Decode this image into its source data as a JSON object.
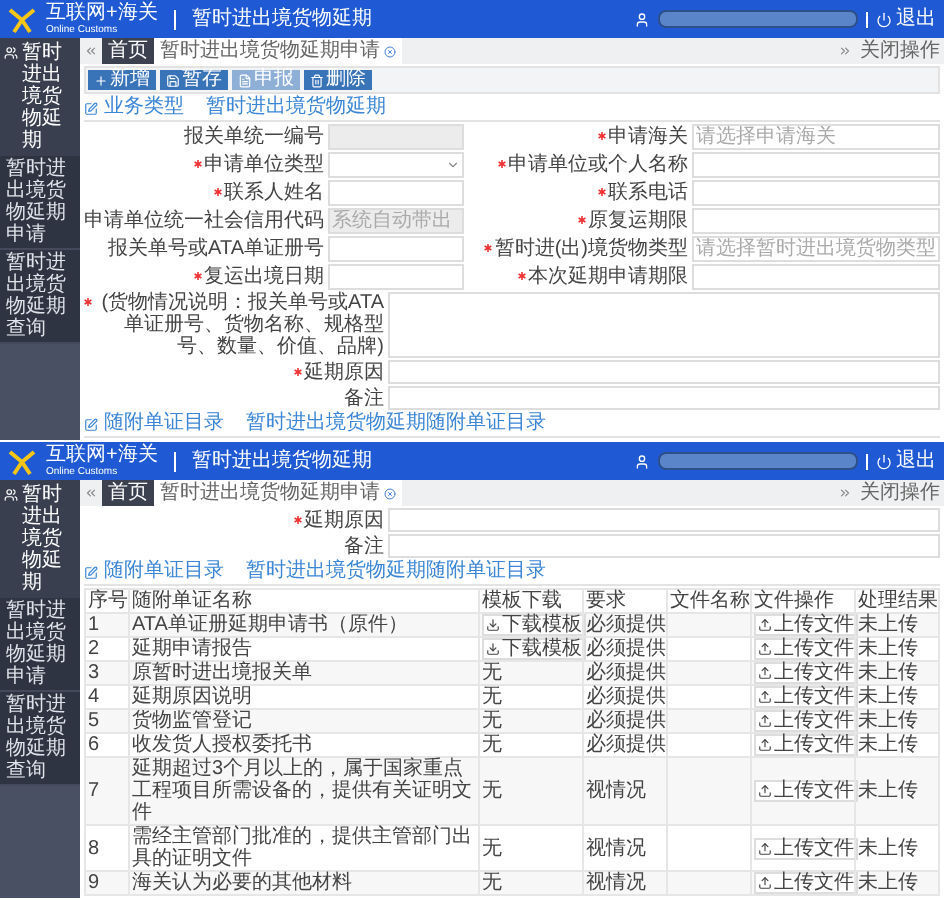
{
  "top_view": {
    "header": {
      "logo_cn": "互联网+海关",
      "logo_en": "Online Customs",
      "title": "暂时进出境货物延期",
      "logout": "退出"
    },
    "sidebar": {
      "group": "暂时进出境货物延期",
      "items": [
        {
          "label": "暂时进出境货物延期申请"
        },
        {
          "label": "暂时进出境货物延期查询"
        }
      ]
    },
    "tabs": {
      "items": [
        {
          "label": "首页",
          "selected": false,
          "closable": false
        },
        {
          "label": "暂时进出境货物延期申请",
          "selected": true,
          "closable": true
        }
      ],
      "close_menu": "关闭操作"
    },
    "toolbar": [
      {
        "kind": "add",
        "label": "新增",
        "disabled": false
      },
      {
        "kind": "save",
        "label": "暂存",
        "disabled": false
      },
      {
        "kind": "declare",
        "label": "申报",
        "disabled": true
      },
      {
        "kind": "delete",
        "label": "删除",
        "disabled": false
      }
    ],
    "section": {
      "title": "业务类型",
      "subtitle": "暂时进出境货物延期"
    },
    "form": [
      {
        "label": "报关单统一编号",
        "required": false,
        "kind": "readonly"
      },
      {
        "label": "申请海关",
        "required": true,
        "kind": "text",
        "placeholder": "请选择申请海关"
      },
      {
        "label": "申请单位类型",
        "required": true,
        "kind": "select"
      },
      {
        "label": "申请单位或个人名称",
        "required": true,
        "kind": "text"
      },
      {
        "label": "联系人姓名",
        "required": true,
        "kind": "text"
      },
      {
        "label": "联系电话",
        "required": true,
        "kind": "text"
      },
      {
        "label": "申请单位统一社会信用代码",
        "required": false,
        "kind": "readonly",
        "placeholder": "系统自动带出"
      },
      {
        "label": "原复运期限",
        "required": true,
        "kind": "text"
      },
      {
        "label": "报关单号或ATA单证册号",
        "required": false,
        "kind": "text"
      },
      {
        "label": "暂时进(出)境货物类型",
        "required": true,
        "kind": "text",
        "placeholder": "请选择暂时进出境货物类型"
      },
      {
        "label": "复运出境日期",
        "required": true,
        "kind": "text"
      },
      {
        "label": "本次延期申请期限",
        "required": true,
        "kind": "text"
      }
    ],
    "textareas": [
      {
        "label": "(货物情况说明：报关单号或ATA单证册号、货物名称、规格型号、数量、价值、品牌)",
        "required": true,
        "kind": "large"
      },
      {
        "label": "延期原因",
        "required": true,
        "kind": "small"
      },
      {
        "label": "备注",
        "required": false,
        "kind": "small"
      }
    ],
    "footer_section": {
      "title": "随附单证目录",
      "subtitle": "暂时进出境货物延期随附单证目录"
    }
  },
  "bottom_view": {
    "header": {
      "logo_cn": "互联网+海关",
      "logo_en": "Online Customs",
      "title": "暂时进出境货物延期",
      "logout": "退出"
    },
    "sidebar": {
      "group": "暂时进出境货物延期",
      "items": [
        {
          "label": "暂时进出境货物延期申请"
        },
        {
          "label": "暂时进出境货物延期查询"
        }
      ]
    },
    "tabs": {
      "items": [
        {
          "label": "首页",
          "selected": false,
          "closable": false
        },
        {
          "label": "暂时进出境货物延期申请",
          "selected": true,
          "closable": true
        }
      ],
      "close_menu": "关闭操作"
    },
    "textareas": [
      {
        "label": "延期原因",
        "required": true,
        "kind": "small"
      },
      {
        "label": "备注",
        "required": false,
        "kind": "small"
      }
    ],
    "section": {
      "title": "随附单证目录",
      "subtitle": "暂时进出境货物延期随附单证目录"
    },
    "table": {
      "columns": [
        "序号",
        "随附单证名称",
        "模板下载",
        "要求",
        "文件名称",
        "文件操作",
        "处理结果"
      ],
      "rows": [
        {
          "no": "1",
          "name": "ATA单证册延期申请书（原件）",
          "template": {
            "kind": "button",
            "label": "下载模板"
          },
          "requirement": "必须提供",
          "action": "上传文件",
          "result": "未上传"
        },
        {
          "no": "2",
          "name": "延期申请报告",
          "template": {
            "kind": "button",
            "label": "下载模板"
          },
          "requirement": "必须提供",
          "action": "上传文件",
          "result": "未上传"
        },
        {
          "no": "3",
          "name": "原暂时进出境报关单",
          "template": {
            "kind": "text",
            "label": "无"
          },
          "requirement": "必须提供",
          "action": "上传文件",
          "result": "未上传"
        },
        {
          "no": "4",
          "name": "延期原因说明",
          "template": {
            "kind": "text",
            "label": "无"
          },
          "requirement": "必须提供",
          "action": "上传文件",
          "result": "未上传"
        },
        {
          "no": "5",
          "name": "货物监管登记",
          "template": {
            "kind": "text",
            "label": "无"
          },
          "requirement": "必须提供",
          "action": "上传文件",
          "result": "未上传"
        },
        {
          "no": "6",
          "name": "收发货人授权委托书",
          "template": {
            "kind": "text",
            "label": "无"
          },
          "requirement": "必须提供",
          "action": "上传文件",
          "result": "未上传"
        },
        {
          "no": "7",
          "name": "延期超过3个月以上的，属于国家重点工程项目所需设备的，提供有关证明文件",
          "template": {
            "kind": "text",
            "label": "无"
          },
          "requirement": "视情况",
          "action": "上传文件",
          "result": "未上传"
        },
        {
          "no": "8",
          "name": "需经主管部门批准的，提供主管部门出具的证明文件",
          "template": {
            "kind": "text",
            "label": "无"
          },
          "requirement": "视情况",
          "action": "上传文件",
          "result": "未上传"
        },
        {
          "no": "9",
          "name": "海关认为必要的其他材料",
          "template": {
            "kind": "text",
            "label": "无"
          },
          "requirement": "视情况",
          "action": "上传文件",
          "result": "未上传"
        }
      ]
    }
  }
}
